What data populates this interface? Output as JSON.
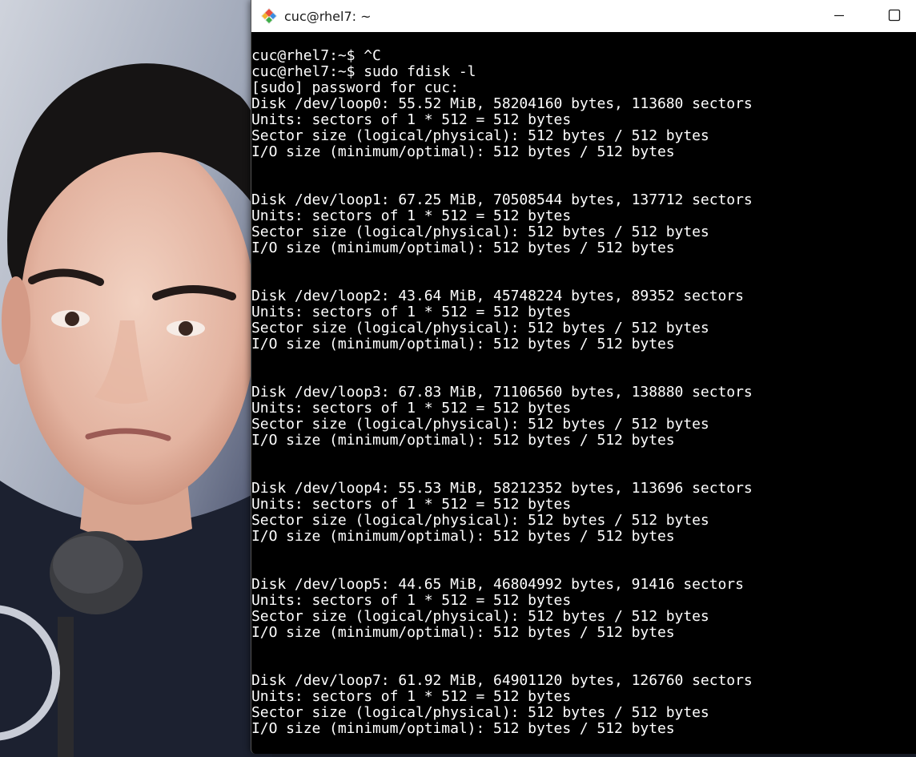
{
  "window": {
    "title": "cuc@rhel7: ~",
    "icon": "git-bash-diamond-icon",
    "controls": [
      "minimize-icon",
      "maximize-icon"
    ]
  },
  "colors": {
    "terminal_background": "#000000",
    "terminal_foreground": "#ffffff",
    "titlebar_background": "#ffffff"
  },
  "terminal": {
    "lines": [
      "cuc@rhel7:~$ ^C",
      "cuc@rhel7:~$ sudo fdisk -l",
      "[sudo] password for cuc:",
      "Disk /dev/loop0: 55.52 MiB, 58204160 bytes, 113680 sectors",
      "Units: sectors of 1 * 512 = 512 bytes",
      "Sector size (logical/physical): 512 bytes / 512 bytes",
      "I/O size (minimum/optimal): 512 bytes / 512 bytes",
      "",
      "",
      "Disk /dev/loop1: 67.25 MiB, 70508544 bytes, 137712 sectors",
      "Units: sectors of 1 * 512 = 512 bytes",
      "Sector size (logical/physical): 512 bytes / 512 bytes",
      "I/O size (minimum/optimal): 512 bytes / 512 bytes",
      "",
      "",
      "Disk /dev/loop2: 43.64 MiB, 45748224 bytes, 89352 sectors",
      "Units: sectors of 1 * 512 = 512 bytes",
      "Sector size (logical/physical): 512 bytes / 512 bytes",
      "I/O size (minimum/optimal): 512 bytes / 512 bytes",
      "",
      "",
      "Disk /dev/loop3: 67.83 MiB, 71106560 bytes, 138880 sectors",
      "Units: sectors of 1 * 512 = 512 bytes",
      "Sector size (logical/physical): 512 bytes / 512 bytes",
      "I/O size (minimum/optimal): 512 bytes / 512 bytes",
      "",
      "",
      "Disk /dev/loop4: 55.53 MiB, 58212352 bytes, 113696 sectors",
      "Units: sectors of 1 * 512 = 512 bytes",
      "Sector size (logical/physical): 512 bytes / 512 bytes",
      "I/O size (minimum/optimal): 512 bytes / 512 bytes",
      "",
      "",
      "Disk /dev/loop5: 44.65 MiB, 46804992 bytes, 91416 sectors",
      "Units: sectors of 1 * 512 = 512 bytes",
      "Sector size (logical/physical): 512 bytes / 512 bytes",
      "I/O size (minimum/optimal): 512 bytes / 512 bytes",
      "",
      "",
      "Disk /dev/loop7: 61.92 MiB, 64901120 bytes, 126760 sectors",
      "Units: sectors of 1 * 512 = 512 bytes",
      "Sector size (logical/physical): 512 bytes / 512 bytes",
      "I/O size (minimum/optimal): 512 bytes / 512 bytes"
    ]
  }
}
